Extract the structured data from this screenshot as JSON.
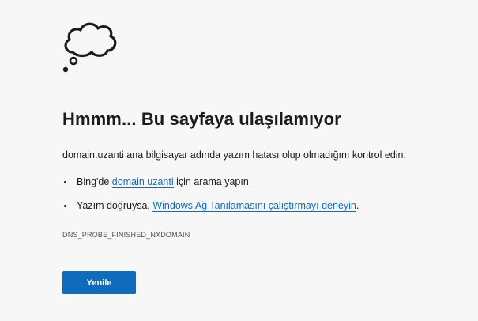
{
  "icon": "thought-cloud-icon",
  "title": "Hmmm... Bu sayfaya ulaşılamıyor",
  "description": "domain.uzanti ana bilgisayar adında yazım hatası olup olmadığını kontrol edin.",
  "suggestions": {
    "bing": {
      "prefix": "Bing'de ",
      "link": "domain uzanti",
      "suffix": " için arama yapın"
    },
    "diagnostics": {
      "prefix": "Yazım doğruysa, ",
      "link": "Windows Ağ Tanılamasını çalıştırmayı deneyin",
      "suffix": "."
    }
  },
  "error_code": "DNS_PROBE_FINISHED_NXDOMAIN",
  "reload_label": "Yenile",
  "colors": {
    "background": "#f7f7f7",
    "accent": "#0f6cbd",
    "text": "#1b1b1b"
  }
}
